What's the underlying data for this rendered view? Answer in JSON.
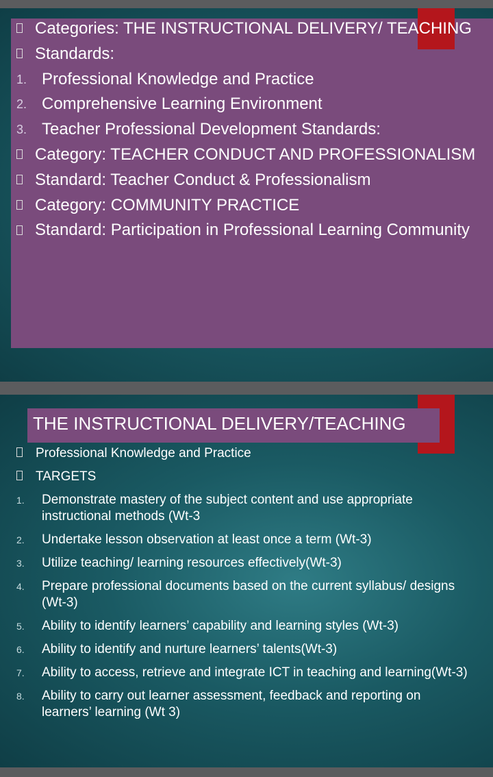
{
  "slide1": {
    "items": [
      {
        "type": "bullet",
        "text": "Categories: THE INSTRUCTIONAL DELIVERY/ TEACHING"
      },
      {
        "type": "bullet",
        "text": "Standards:"
      },
      {
        "type": "number",
        "marker": "1.",
        "text": "Professional Knowledge and Practice"
      },
      {
        "type": "number",
        "marker": "2.",
        "text": "Comprehensive Learning Environment"
      },
      {
        "type": "number",
        "marker": "3.",
        "text": "Teacher Professional Development Standards:"
      },
      {
        "type": "bullet",
        "text": "Category: TEACHER CONDUCT AND PROFESSIONALISM"
      },
      {
        "type": "bullet",
        "text": "Standard: Teacher Conduct & Professionalism"
      },
      {
        "type": "bullet",
        "text": "Category: COMMUNITY PRACTICE"
      },
      {
        "type": "bullet",
        "text": "Standard: Participation in Professional Learning Community"
      }
    ]
  },
  "slide2": {
    "title": "THE INSTRUCTIONAL DELIVERY/TEACHING",
    "items": [
      {
        "type": "bullet",
        "text": "Professional Knowledge and Practice"
      },
      {
        "type": "bullet",
        "text": "TARGETS"
      },
      {
        "type": "number",
        "marker": "1.",
        "text": "Demonstrate mastery of the subject content and use appropriate instructional methods (Wt-3"
      },
      {
        "type": "number",
        "marker": "2.",
        "text": "Undertake lesson observation at least once a term (Wt-3)"
      },
      {
        "type": "number",
        "marker": "3.",
        "text": "Utilize teaching/ learning resources effectively(Wt-3)"
      },
      {
        "type": "number",
        "marker": "4.",
        "text": "Prepare professional documents based on the current syllabus/ designs (Wt-3)"
      },
      {
        "type": "number",
        "marker": "5.",
        "text": "Ability to identify learners’ capability and learning styles (Wt-3)"
      },
      {
        "type": "number",
        "marker": "6.",
        "text": "Ability to identify and nurture learners’ talents(Wt-3)"
      },
      {
        "type": "number",
        "marker": "7.",
        "text": "Ability to access, retrieve and integrate ICT in teaching and learning(Wt-3)"
      },
      {
        "type": "number",
        "marker": "8.",
        "text": "Ability to carry out learner assessment, feedback and reporting on learners’ learning (Wt 3)"
      }
    ]
  }
}
